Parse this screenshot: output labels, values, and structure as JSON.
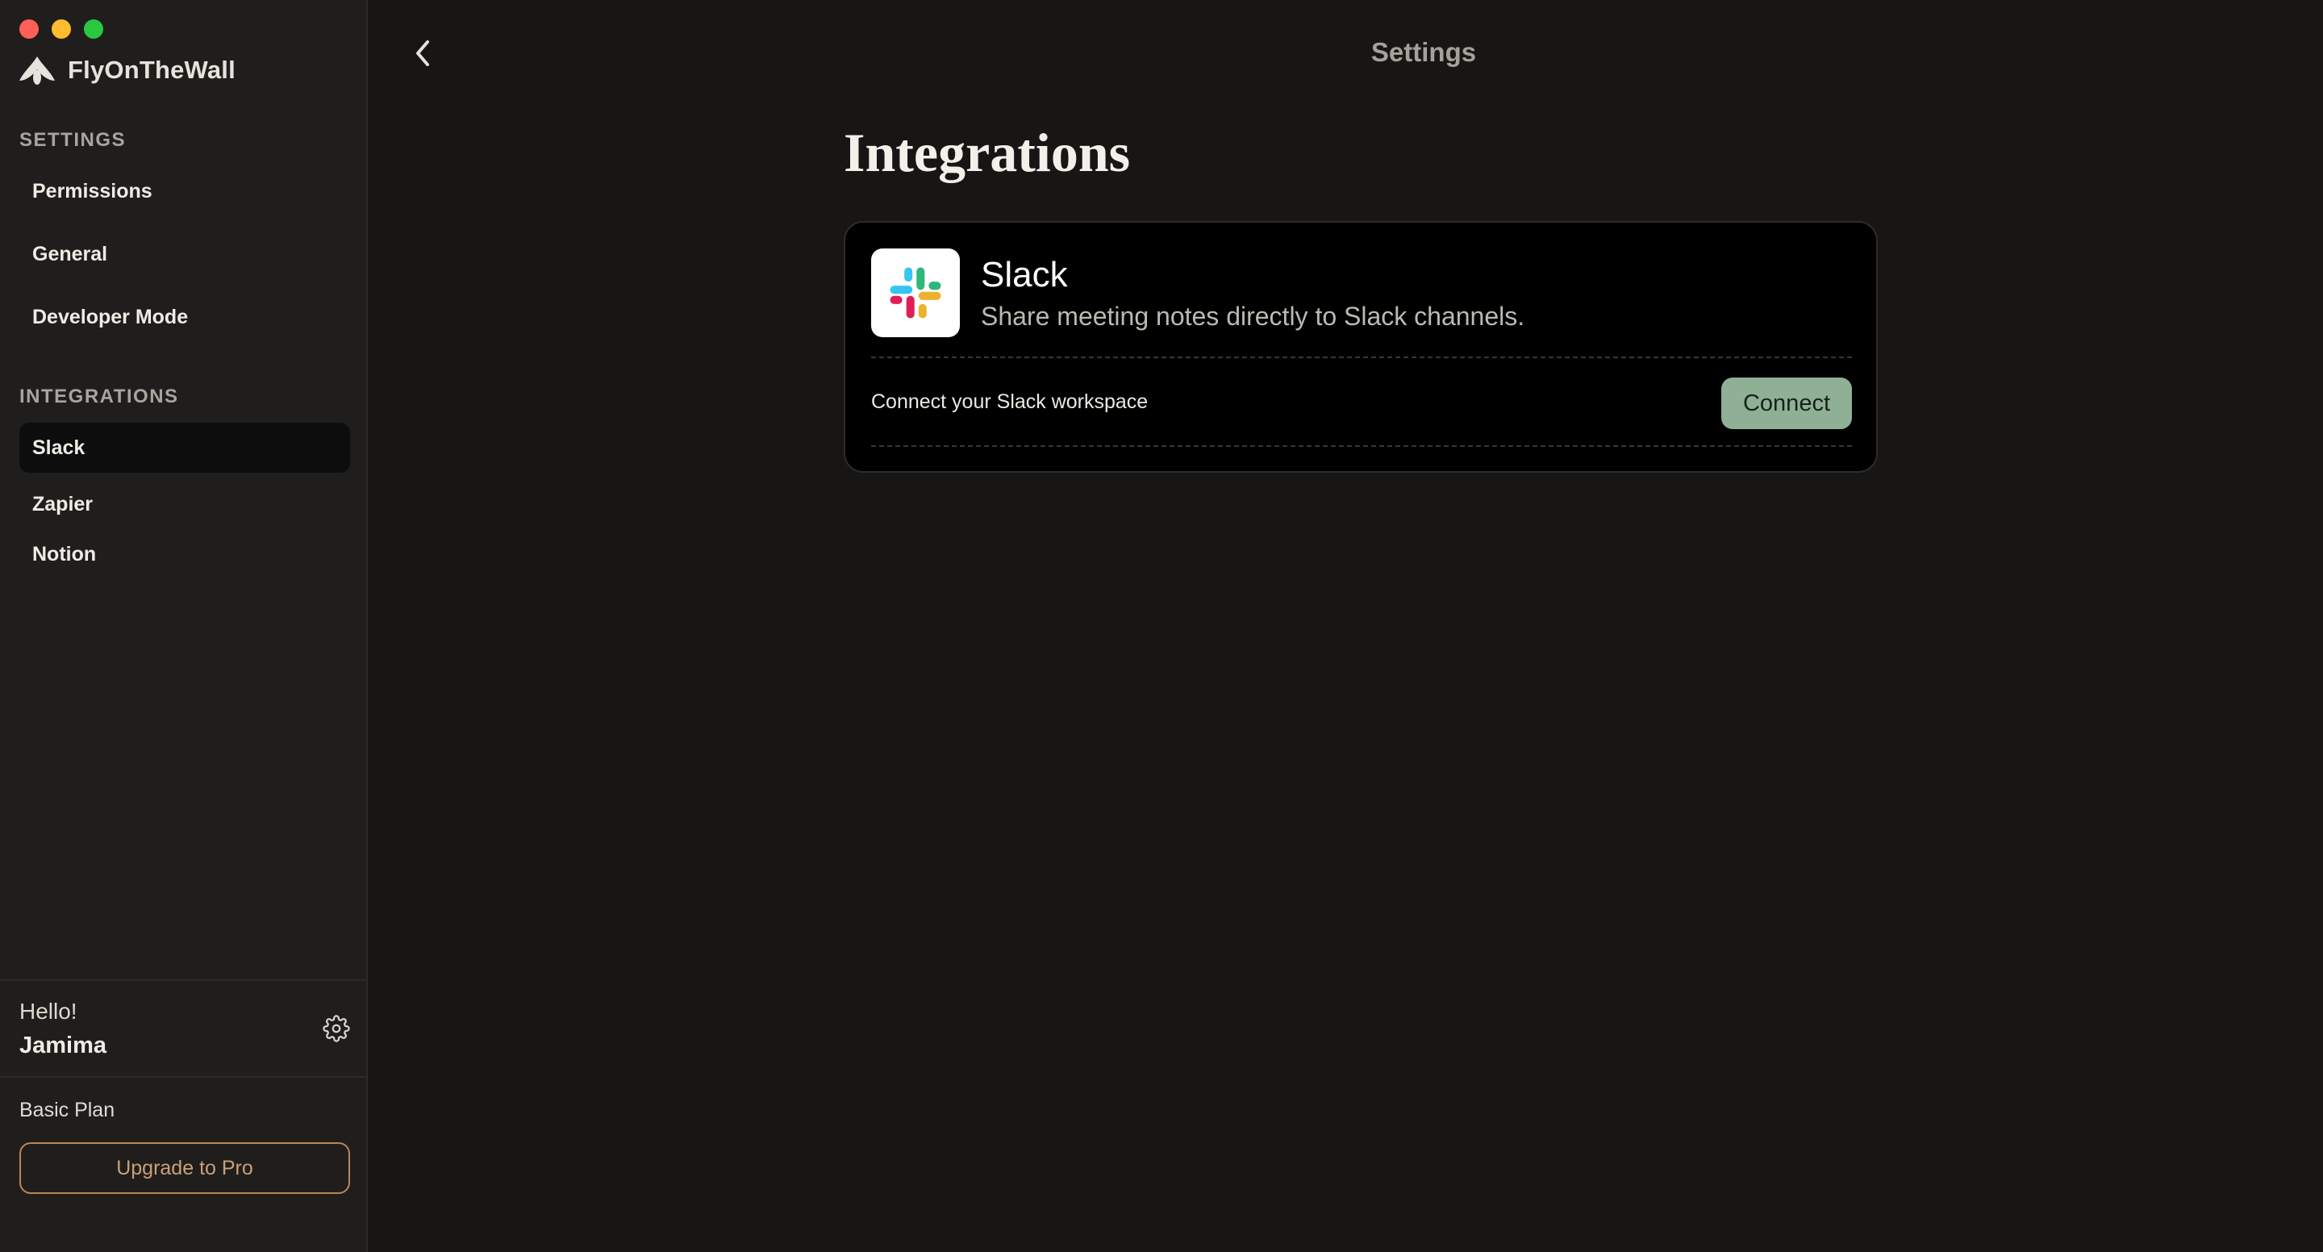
{
  "app": {
    "name": "FlyOnTheWall"
  },
  "header": {
    "title": "Settings"
  },
  "sidebar": {
    "settings_title": "SETTINGS",
    "settings_items": [
      {
        "label": "Permissions"
      },
      {
        "label": "General"
      },
      {
        "label": "Developer Mode"
      }
    ],
    "integrations_title": "INTEGRATIONS",
    "integration_items": [
      {
        "label": "Slack",
        "active": true
      },
      {
        "label": "Zapier",
        "active": false
      },
      {
        "label": "Notion",
        "active": false
      }
    ],
    "user": {
      "greeting": "Hello!",
      "name": "Jamima"
    },
    "plan": "Basic Plan",
    "upgrade_label": "Upgrade to Pro"
  },
  "main": {
    "page_title": "Integrations",
    "card": {
      "icon": "slack-logo-icon",
      "title": "Slack",
      "description": "Share meeting notes directly to Slack channels.",
      "connect_text": "Connect your Slack workspace",
      "connect_button": "Connect"
    }
  },
  "colors": {
    "accent_green": "#8fb095",
    "upgrade_border": "#b8865c",
    "background": "#171615",
    "sidebar": "#201e1c"
  }
}
